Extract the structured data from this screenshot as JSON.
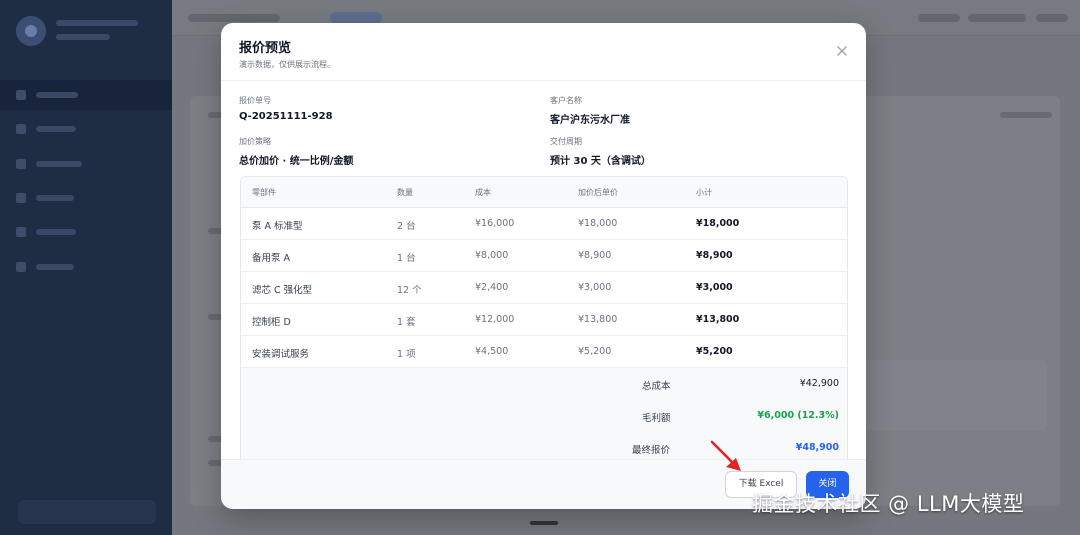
{
  "modal": {
    "title": "报价预览",
    "subtitle": "演示数据，仅供展示流程。",
    "info": {
      "quote_no_label": "报价单号",
      "quote_no": "Q-20251111-928",
      "customer_label": "客户名称",
      "customer": "客户沪东污水厂准",
      "strategy_label": "加价策略",
      "strategy": "总价加价 · 统一比例/金额",
      "delivery_label": "交付周期",
      "delivery": "预计 30 天（含调试）"
    },
    "table": {
      "headers": [
        "零部件",
        "数量",
        "成本",
        "加价后单价",
        "小计"
      ],
      "rows": [
        {
          "part": "泵 A 标准型",
          "qty": "2 台",
          "cost": "¥16,000",
          "unit_price": "¥18,000",
          "subtotal": "¥18,000"
        },
        {
          "part": "备用泵 A",
          "qty": "1 台",
          "cost": "¥8,000",
          "unit_price": "¥8,900",
          "subtotal": "¥8,900"
        },
        {
          "part": "滤芯 C 强化型",
          "qty": "12 个",
          "cost": "¥2,400",
          "unit_price": "¥3,000",
          "subtotal": "¥3,000"
        },
        {
          "part": "控制柜 D",
          "qty": "1 套",
          "cost": "¥12,000",
          "unit_price": "¥13,800",
          "subtotal": "¥13,800"
        },
        {
          "part": "安装调试服务",
          "qty": "1 项",
          "cost": "¥4,500",
          "unit_price": "¥5,200",
          "subtotal": "¥5,200"
        }
      ]
    },
    "summary": {
      "total_cost_label": "总成本",
      "total_cost": "¥42,900",
      "gross_profit_label": "毛利额",
      "gross_profit": "¥6,000 (12.3%)",
      "final_price_label": "最终报价",
      "final_price": "¥48,900"
    },
    "footer": {
      "download_label": "下载 Excel",
      "close_label": "关闭"
    }
  },
  "watermark": "掘金技术社区 @ LLM大模型",
  "colors": {
    "primary": "#2563eb",
    "profit_green": "#16a34a",
    "final_blue": "#2563eb",
    "sidebar": "#1f2d44",
    "arrow_red": "#e02424"
  },
  "icons": {
    "close": "close-icon",
    "annotation_arrow": "arrow-icon"
  }
}
